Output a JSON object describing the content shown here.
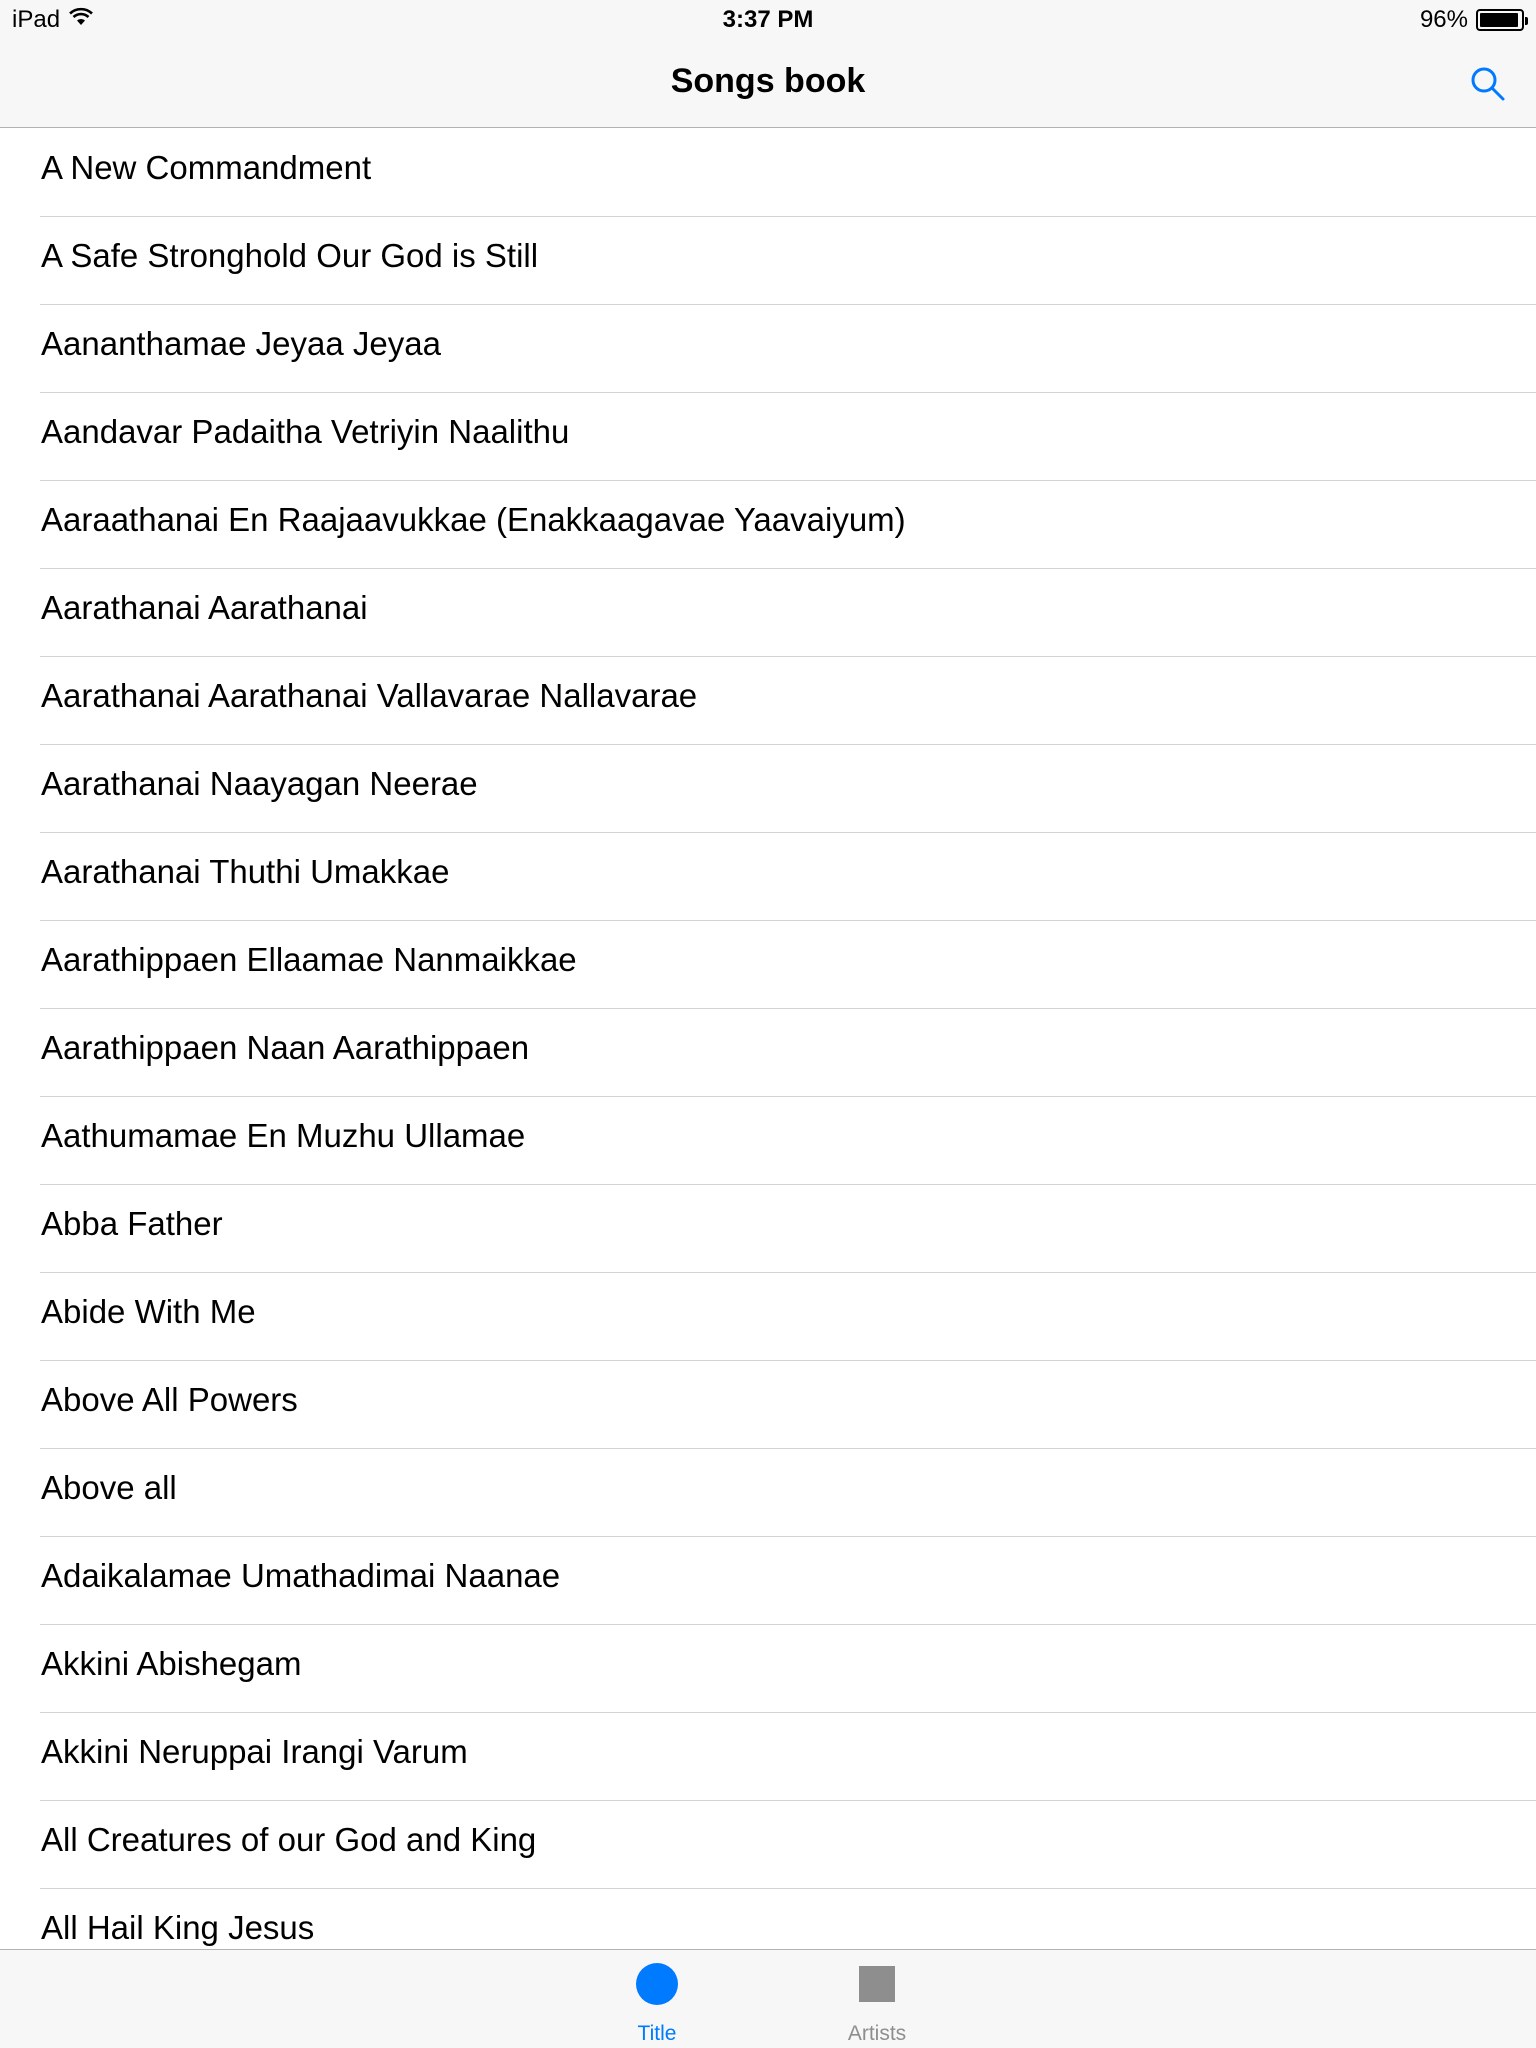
{
  "status": {
    "device": "iPad",
    "time": "3:37 PM",
    "battery_text": "96%",
    "battery_level": 0.96
  },
  "nav": {
    "title": "Songs book",
    "search_icon": "search-icon"
  },
  "songs": [
    "A New Commandment",
    "A Safe Stronghold Our God is Still",
    "Aananthamae Jeyaa Jeyaa",
    "Aandavar Padaitha Vetriyin Naalithu",
    "Aaraathanai En Raajaavukkae (Enakkaagavae Yaavaiyum)",
    "Aarathanai Aarathanai",
    "Aarathanai Aarathanai Vallavarae Nallavarae",
    "Aarathanai Naayagan Neerae",
    "Aarathanai Thuthi Umakkae",
    "Aarathippaen Ellaamae Nanmaikkae",
    "Aarathippaen Naan Aarathippaen",
    "Aathumamae En Muzhu Ullamae",
    "Abba Father",
    "Abide With Me",
    "Above All Powers",
    "Above all",
    "Adaikalamae Umathadimai Naanae",
    "Akkini Abishegam",
    "Akkini Neruppai Irangi Varum",
    "All Creatures of our God and King",
    "All Hail King Jesus"
  ],
  "tabs": {
    "title_label": "Title",
    "artists_label": "Artists"
  },
  "colors": {
    "accent": "#007aff",
    "inactive": "#8e8e8e",
    "bar_bg": "#f7f7f7",
    "separator": "#d4d4d4"
  }
}
